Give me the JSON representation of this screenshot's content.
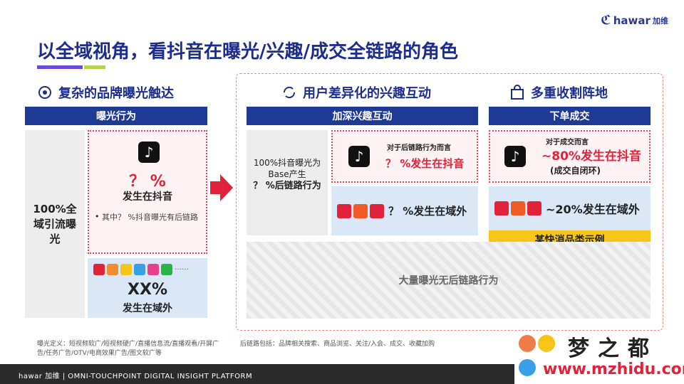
{
  "brand": {
    "logo_text": "hawar",
    "logo_cn": "加维"
  },
  "title": "以全域视角，看抖音在曝光/兴趣/成交全链路的角色",
  "left_section": {
    "heading": "复杂的品牌曝光触达",
    "bar": "曝光行为",
    "side_label": "100%全域引流曝光",
    "douyin_pct": "？ %",
    "douyin_label": "发生在抖音",
    "bullet": "其中？ %抖音曝光有后链路",
    "outside_pct": "XX%",
    "outside_label": "发生在域外",
    "more": "……"
  },
  "mid_section": {
    "heading": "用户差异化的兴趣互动",
    "bar": "加深兴趣互动",
    "side_label_line1": "100%抖音曝光为Base产生",
    "side_label_line2": "？ %后链路行为",
    "douyin_caption": "对于后链路行为而言",
    "douyin_value": "？ %发生在抖音",
    "outside_value": "？ %发生在域外"
  },
  "right_section": {
    "heading": "多重收割阵地",
    "bar": "下单成交",
    "douyin_caption": "对于成交而言",
    "douyin_value": "~80%发生在抖音",
    "douyin_note": "(成交自闭环)",
    "outside_value": "~20%发生在域外",
    "example_tag": "某快消品类示例"
  },
  "bottom_grey": "大量曝光无后链路行为",
  "footnotes": {
    "exposure_def": "曝光定义：短视频软广/短视频硬广/直播信息流/直播观看/开屏广告/任务广告/OTV/电商效果广告/图文软广等",
    "chain_def": "后链路包括：品牌相关搜索、商品浏览、关注/入会、成交、收藏加购"
  },
  "footer_text": "hawar 加维 | OMNI-TOUCHPOINT DIGITAL INSIGHT PLATFORM",
  "watermark": {
    "cn": "梦之都",
    "url": "www.mzhidu.com"
  },
  "colors": {
    "navy": "#1e3a94",
    "red": "#e0233a",
    "yellow": "#f5c518"
  }
}
